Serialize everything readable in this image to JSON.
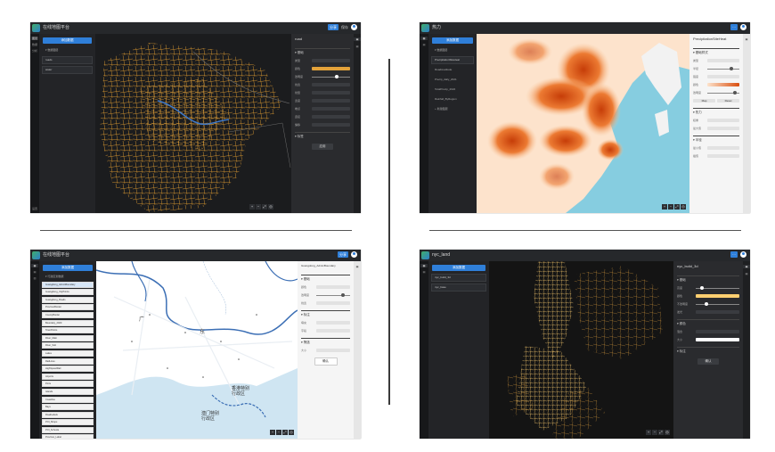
{
  "layout_dividers": true,
  "panel1": {
    "app_title": "在线地图平台",
    "share_button": "分享",
    "save_text": "保存",
    "icon_tabs": [
      "图层",
      "数据",
      "分析"
    ],
    "bottom_tab": "设置",
    "add_layer_button": "添加数据",
    "layer_group": "▾ 数据图层",
    "layers": [
      "roads",
      "water"
    ],
    "props_title": "road",
    "props_sections": [
      "▾ 基础",
      "▾ 标签"
    ],
    "props_labels": [
      "类型",
      "颜色",
      "透明度",
      "线宽",
      "线型",
      "宽度",
      "端点",
      "连接",
      "偏移"
    ],
    "apply_button": "应用",
    "zoom": [
      "+",
      "−",
      "⤢",
      "◎"
    ],
    "colors": {
      "road": "#e3a23a",
      "water": "#3d78c9",
      "bg": "#1b1c1e"
    }
  },
  "panel2": {
    "app_title": "热力",
    "add_layer_button": "添加数据",
    "layer_group": "▾ 数据图层",
    "layers": [
      "PrecipitationSiteHeat",
      "RoadsLatitude",
      "Precip_daily_2021",
      "TotalPrecip_2022",
      "Rainfall_ByRegion"
    ],
    "extra_layer": "+ 新建图层",
    "props_title": "PrecipitationSiteHeat",
    "props_sections": [
      "▾ 基础样式",
      "▾ 热力",
      "▾ 半径"
    ],
    "props_labels": [
      "类型",
      "半径",
      "强度",
      "颜色",
      "透明度",
      "权重",
      "最大值",
      "最小值",
      "插值"
    ],
    "buttons": [
      "Map",
      "Reset"
    ],
    "zoom": [
      "+",
      "−",
      "⤢",
      "◎"
    ],
    "colors": {
      "hot": "#d94e0f",
      "warm": "#f4a15e",
      "cool": "#fde3cc",
      "sea": "#86cde0"
    }
  },
  "panel3": {
    "app_title": "在线地图平台",
    "share_button": "分享",
    "add_layer_button": "添加数据",
    "layer_group": "▾ 行政区划数据",
    "layers": [
      "Guangdong_AdminBoundary",
      "Guangdong_CityPoints",
      "Guangdong_Roads",
      "ProvinceBorder",
      "CountyBorder",
      "Boundary_2020",
      "TownPoints",
      "River_Main",
      "River_Sub",
      "Lakes",
      "RailLines",
      "HighSpeedRail",
      "Airports",
      "Ports",
      "Islands",
      "Coastline",
      "Bays",
      "RoadLabels",
      "POI_Shops",
      "POI_Schools",
      "Province_Label"
    ],
    "selected_layer": "Guangdong_AdminBoundary",
    "props_title": "Guangdong_AdminBoundary",
    "props_sections": [
      "▾ 基础",
      "▾ 标注",
      "▾ 筛选"
    ],
    "props_labels": [
      "颜色",
      "透明度",
      "线宽",
      "填充",
      "字段",
      "大小"
    ],
    "apply_button": "确认",
    "map_labels": [
      "广",
      "东",
      "香港特别行政区",
      "澳门特别行政区"
    ],
    "zoom": [
      "+",
      "−",
      "⤢",
      "◎"
    ],
    "colors": {
      "border": "#3c6fb5",
      "land": "#ffffff",
      "sea": "#cfe5f2",
      "road": "#e9eef3"
    }
  },
  "panel4": {
    "app_title": "nyc_land",
    "add_layer_button": "添加数据",
    "layers": [
      "nyc_build_3d",
      "nyc_base"
    ],
    "props_title": "nyc_build_3d",
    "props_sections": [
      "▾ 基础",
      "▾ 颜色",
      "▾ 标注"
    ],
    "props_labels": [
      "高度",
      "颜色",
      "不透明度",
      "发光",
      "混合",
      "大小"
    ],
    "apply_button": "确认",
    "zoom": [
      "+",
      "−",
      "⤢",
      "◎"
    ],
    "colors": {
      "light": "#ffcf70",
      "bg": "#141414"
    }
  }
}
